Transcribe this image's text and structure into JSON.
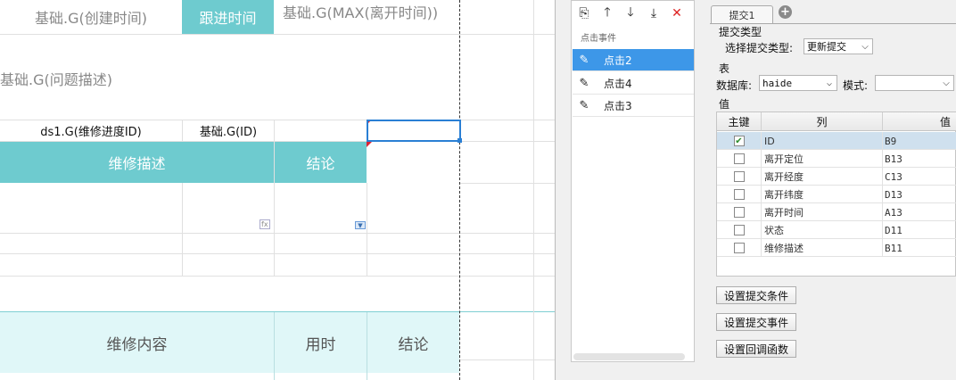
{
  "sheet": {
    "header_row": [
      "基础.G(创建时间)",
      "跟进时间",
      "基础.G(MAX(离开时间))"
    ],
    "problem_desc": "基础.G(问题描述)",
    "ds_row": [
      "ds1.G(维修进度ID)",
      "基础.G(ID)"
    ],
    "teal_row": [
      "维修描述",
      "结论"
    ],
    "fx_tag": "fx",
    "bottom_row": [
      "维修内容",
      "用时",
      "结论"
    ],
    "colors": {
      "teal": "#6ecbcf",
      "light_teal": "#e0f7f8",
      "selection": "#2a7fd4"
    }
  },
  "events": {
    "toolbar": [
      {
        "icon": "copy-icon",
        "glyph": "⎘"
      },
      {
        "icon": "arrow-up-icon",
        "glyph": "🡑"
      },
      {
        "icon": "arrow-down-icon",
        "glyph": "🡓"
      },
      {
        "icon": "move-bottom-icon",
        "glyph": "⤓"
      },
      {
        "icon": "delete-icon",
        "glyph": "✕"
      }
    ],
    "header": "点击事件",
    "items": [
      "点击2",
      "点击4",
      "点击3"
    ],
    "active_index": 0
  },
  "submit": {
    "tab_label": "提交1",
    "add_tab": "+",
    "type_section": "提交类型",
    "type_label": "选择提交类型:",
    "type_value": "更新提交",
    "table_section": "表",
    "db_label": "数据库:",
    "db_value": "haide",
    "mode_label": "模式:",
    "mode_value": "",
    "value_section": "值",
    "columns": [
      "主键",
      "列",
      "值"
    ],
    "rows": [
      {
        "key": true,
        "col": "ID",
        "val": "B9"
      },
      {
        "key": false,
        "col": "离开定位",
        "val": "B13"
      },
      {
        "key": false,
        "col": "离开经度",
        "val": "C13"
      },
      {
        "key": false,
        "col": "离开纬度",
        "val": "D13"
      },
      {
        "key": false,
        "col": "离开时间",
        "val": "A13"
      },
      {
        "key": false,
        "col": "状态",
        "val": "D11"
      },
      {
        "key": false,
        "col": "维修描述",
        "val": "B11"
      }
    ],
    "buttons": [
      "设置提交条件",
      "设置提交事件",
      "设置回调函数"
    ]
  }
}
